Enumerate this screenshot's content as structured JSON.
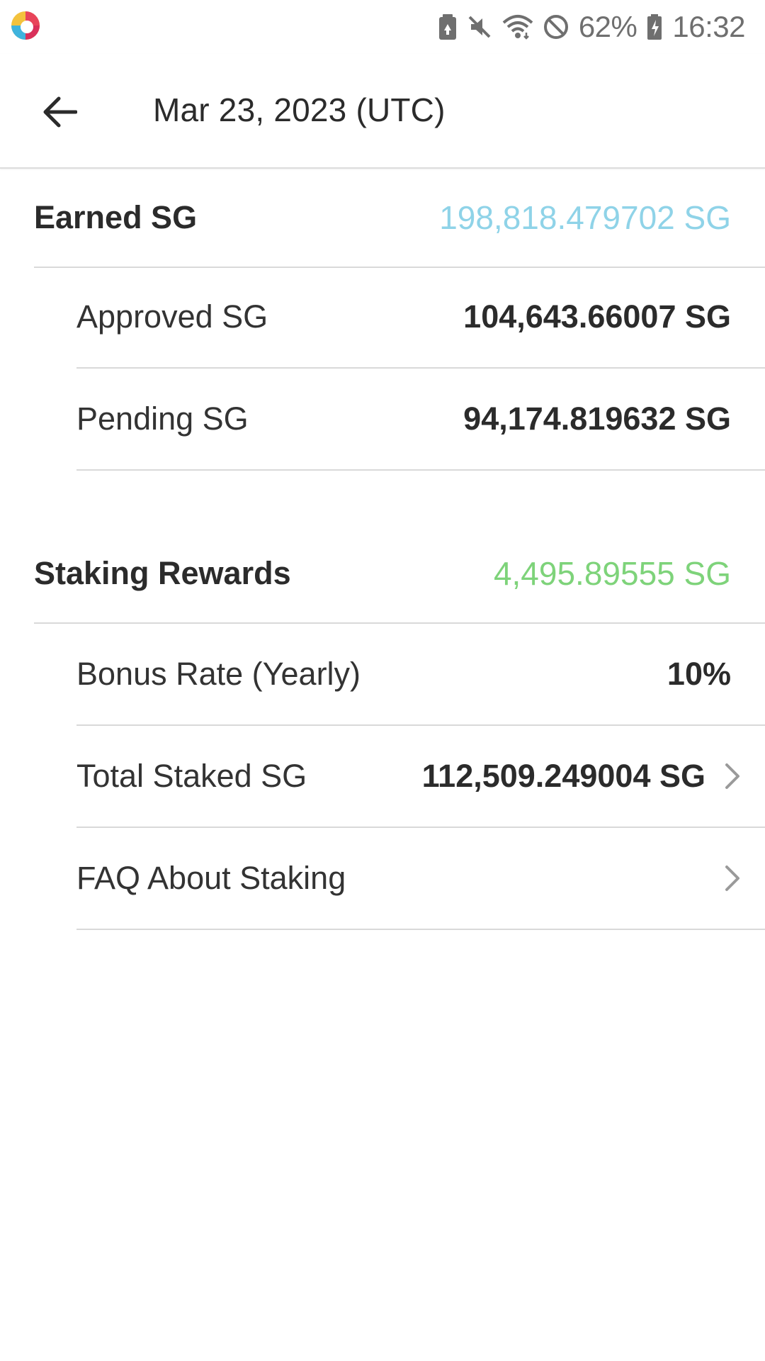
{
  "status_bar": {
    "battery_percent": "62%",
    "time": "16:32"
  },
  "app_bar": {
    "title": "Mar 23, 2023 (UTC)"
  },
  "earned": {
    "label": "Earned SG",
    "value": "198,818.479702 SG",
    "value_color": "#8fd3e8",
    "rows": [
      {
        "label": "Approved SG",
        "value": "104,643.66007 SG"
      },
      {
        "label": "Pending SG",
        "value": "94,174.819632 SG"
      }
    ]
  },
  "staking": {
    "label": "Staking Rewards",
    "value": "4,495.89555 SG",
    "value_color": "#7ed37a",
    "rows": [
      {
        "label": "Bonus Rate (Yearly)",
        "value": "10%"
      },
      {
        "label": "Total Staked SG",
        "value": "112,509.249004 SG"
      },
      {
        "label": "FAQ About Staking"
      }
    ]
  },
  "icons": {
    "app_logo": "app-logo-icon",
    "back": "arrow-left-icon",
    "chevron": "chevron-right-icon"
  }
}
